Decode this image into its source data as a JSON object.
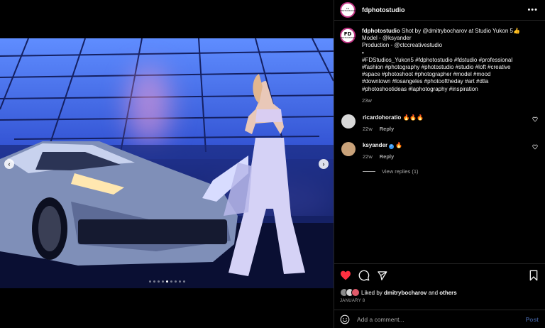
{
  "post": {
    "username": "fdphotostudio",
    "avatar_logo": "FD",
    "avatar_logo_sub": "PHOTOSTUDIO",
    "more_icon": "more-horizontal-icon"
  },
  "caption": {
    "username": "fdphotostudio",
    "lines": [
      "Shot by @dmitrybocharov at Studio Yukon 5👍",
      "Model - @ksyander",
      "Production - @ctccreativestudio",
      "•",
      "#FDStudios_Yukon5 #fdphotostudio #fdstudio #professional",
      "#fashion #photography #photostudio #studio #loft #creative",
      "#space #photoshoot #photographer #model #mood",
      "#downtown #losangeles #photooftheday #art #dtla",
      "#photoshootideas #laphotography #inspiration"
    ],
    "time": "23w"
  },
  "comments": [
    {
      "username": "ricardohoratio",
      "verified": false,
      "text": "🔥🔥🔥",
      "time": "22w",
      "reply_label": "Reply",
      "avatar_color": "#d9d9d9"
    },
    {
      "username": "ksyander",
      "verified": true,
      "text": "🔥",
      "time": "22w",
      "reply_label": "Reply",
      "avatar_color": "#c9a27a"
    }
  ],
  "view_replies": "View replies (1)",
  "likes": {
    "prefix": "Liked by ",
    "user": "dmitrybocharov",
    "middle": " and ",
    "others": "others"
  },
  "date": "JANUARY 8",
  "comment_input": {
    "placeholder": "Add a comment...",
    "post_label": "Post"
  },
  "carousel": {
    "count": 9,
    "active_index": 4
  },
  "colors": {
    "like_red": "#ff3040",
    "post_blue": "#385185",
    "ring": "#c13584"
  }
}
